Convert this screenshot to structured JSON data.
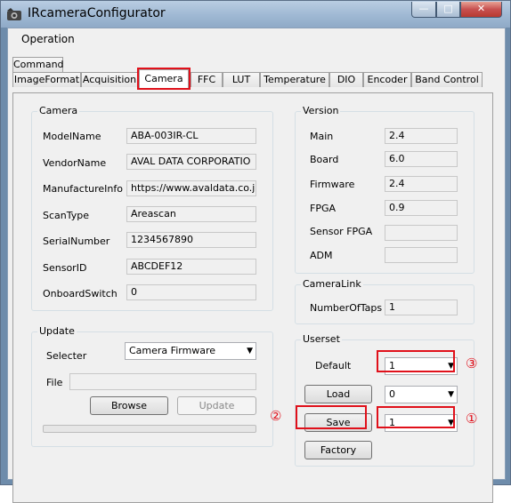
{
  "window": {
    "title": "IRcameraConfigurator",
    "controls": {
      "minimize": "—",
      "maximize": "□",
      "close": "✕"
    }
  },
  "menu": {
    "operation": "Operation"
  },
  "tabs_row1": [
    {
      "label": "Command"
    }
  ],
  "tabs_row2": [
    {
      "label": "ImageFormat"
    },
    {
      "label": "Acquisition"
    },
    {
      "label": "Camera",
      "active": true
    },
    {
      "label": "FFC"
    },
    {
      "label": "LUT"
    },
    {
      "label": "Temperature"
    },
    {
      "label": "DIO"
    },
    {
      "label": "Encoder"
    },
    {
      "label": "Band Control"
    }
  ],
  "camera": {
    "title": "Camera",
    "fields": [
      {
        "label": "ModelName",
        "value": "ABA-003IR-CL"
      },
      {
        "label": "VendorName",
        "value": "AVAL DATA CORPORATIO"
      },
      {
        "label": "ManufactureInfo",
        "value": "https://www.avaldata.co.jp"
      },
      {
        "label": "ScanType",
        "value": "Areascan"
      },
      {
        "label": "SerialNumber",
        "value": "1234567890"
      },
      {
        "label": "SensorID",
        "value": "ABCDEF12"
      },
      {
        "label": "OnboardSwitch",
        "value": "0"
      }
    ]
  },
  "version": {
    "title": "Version",
    "fields": [
      {
        "label": "Main",
        "value": "2.4"
      },
      {
        "label": "Board",
        "value": "6.0"
      },
      {
        "label": "Firmware",
        "value": "2.4"
      },
      {
        "label": "FPGA",
        "value": "0.9"
      },
      {
        "label": "Sensor FPGA",
        "value": ""
      },
      {
        "label": "ADM",
        "value": ""
      }
    ]
  },
  "cameralink": {
    "title": "CameraLink",
    "label": "NumberOfTaps",
    "value": "1"
  },
  "update": {
    "title": "Update",
    "selecter_label": "Selecter",
    "selecter_value": "Camera Firmware",
    "file_label": "File",
    "file_value": "",
    "browse": "Browse",
    "update": "Update",
    "progress": 0
  },
  "userset": {
    "title": "Userset",
    "default_label": "Default",
    "default_value": "1",
    "load": "Load",
    "load_value": "0",
    "save": "Save",
    "save_value": "1",
    "factory": "Factory"
  },
  "markers": {
    "one": "①",
    "two": "②",
    "three": "③"
  },
  "colors": {
    "highlight": "#e0101a",
    "progress": "#06b025"
  }
}
